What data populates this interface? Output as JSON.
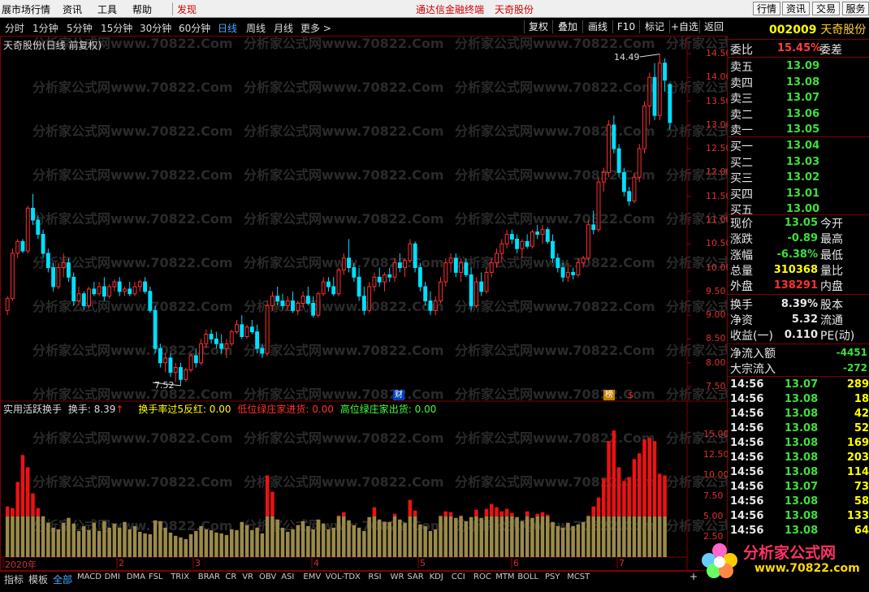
{
  "menu": {
    "items": [
      "展市场行情",
      "资讯",
      "工具",
      "帮助",
      "发现"
    ],
    "center_link": "通达信金融终端",
    "center_name": "天奇股份",
    "right_buttons": [
      "行情",
      "资讯",
      "交易",
      "服务"
    ]
  },
  "toolbar": {
    "timeframes": [
      "分时",
      "1分钟",
      "5分钟",
      "15分钟",
      "30分钟",
      "60分钟",
      "日线",
      "周线",
      "月线",
      "更多 >"
    ],
    "active": "日线",
    "actions": [
      "复权",
      "叠加",
      "画线",
      "F10",
      "标记",
      "+自选",
      "返回"
    ]
  },
  "chart_title": "天奇股份(日线 前复权)",
  "watermark": "分析家公式网www.70822.Com",
  "stock": {
    "code": "002009",
    "name": "天奇股份"
  },
  "order_book": {
    "weibi_label": "委比",
    "weibi_value": "15.45%",
    "weicha_label": "委差",
    "asks": [
      {
        "label": "卖五",
        "price": "13.09"
      },
      {
        "label": "卖四",
        "price": "13.08"
      },
      {
        "label": "卖三",
        "price": "13.07"
      },
      {
        "label": "卖二",
        "price": "13.06"
      },
      {
        "label": "卖一",
        "price": "13.05"
      }
    ],
    "bids": [
      {
        "label": "买一",
        "price": "13.04"
      },
      {
        "label": "买二",
        "price": "13.03"
      },
      {
        "label": "买三",
        "price": "13.02"
      },
      {
        "label": "买四",
        "price": "13.01"
      },
      {
        "label": "买五",
        "price": "13.00"
      }
    ]
  },
  "quote": [
    {
      "label": "现价",
      "value": "13.05",
      "color": "#3ce03c",
      "label2": "今开"
    },
    {
      "label": "涨跌",
      "value": "-0.89",
      "color": "#3ce03c",
      "label2": "最高"
    },
    {
      "label": "涨幅",
      "value": "-6.38%",
      "color": "#3ce03c",
      "label2": "最低"
    },
    {
      "label": "总量",
      "value": "310368",
      "color": "#ffff00",
      "label2": "量比"
    },
    {
      "label": "外盘",
      "value": "138291",
      "color": "#ff3030",
      "label2": "内盘"
    },
    {
      "label": "换手",
      "value": "8.39%",
      "color": "#e8e8e8",
      "label2": "股本"
    },
    {
      "label": "净资",
      "value": "5.32",
      "color": "#e8e8e8",
      "label2": "流通"
    },
    {
      "label": "收益(一)",
      "value": "0.110",
      "color": "#e8e8e8",
      "label2": "PE(动)"
    }
  ],
  "flow": [
    {
      "label": "净流入额",
      "value": "-4451"
    },
    {
      "label": "大宗流入",
      "value": "-272"
    }
  ],
  "trades": [
    {
      "time": "14:56",
      "price": "13.07",
      "vol": "289"
    },
    {
      "time": "14:56",
      "price": "13.08",
      "vol": "18"
    },
    {
      "time": "14:56",
      "price": "13.08",
      "vol": "42"
    },
    {
      "time": "14:56",
      "price": "13.08",
      "vol": "52"
    },
    {
      "time": "14:56",
      "price": "13.08",
      "vol": "169"
    },
    {
      "time": "14:56",
      "price": "13.08",
      "vol": "203"
    },
    {
      "time": "14:56",
      "price": "13.08",
      "vol": "114"
    },
    {
      "time": "14:56",
      "price": "13.07",
      "vol": "73"
    },
    {
      "time": "14:56",
      "price": "13.08",
      "vol": "58"
    },
    {
      "time": "14:56",
      "price": "13.08",
      "vol": "133"
    },
    {
      "time": "14:56",
      "price": "13.08",
      "vol": "64"
    }
  ],
  "price_axis": [
    "14.50",
    "14.00",
    "13.50",
    "13.00",
    "12.50",
    "12.00",
    "11.50",
    "11.00",
    "10.50",
    "10.00",
    "9.50",
    "9.00",
    "8.50",
    "8.00",
    "7.50"
  ],
  "annotations": {
    "high": "14.49",
    "low": "7.52",
    "cai": "财",
    "bang": "榜"
  },
  "indicator": {
    "name": "实用活跃换手",
    "huanshou": "换手: 8.39",
    "l1": "换手率过5反红: 0.00",
    "l2": "低位绿庄家进货: 0.00",
    "l3": "高位绿庄家出货: 0.00"
  },
  "ind_axis": [
    "15.00",
    "12.50",
    "10.00",
    "7.50",
    "5.00",
    "2.50"
  ],
  "date_labels": [
    "2020年",
    "2",
    "3",
    "4",
    "5",
    "6",
    "7"
  ],
  "bottom_tabs": [
    "指标",
    "模板",
    "全部",
    "MACD",
    "DMI",
    "DMA",
    "FSL",
    "TRIX",
    "BRAR",
    "CR",
    "VR",
    "OBV",
    "ASI",
    "EMV",
    "VOL-TDX",
    "RSI",
    "WR",
    "SAR",
    "KDJ",
    "CCI",
    "ROC",
    "MTM",
    "BOLL",
    "PSY",
    "MCST"
  ],
  "logo": {
    "text": "分析家公式网",
    "url": "www.70822.com"
  },
  "chart_data": {
    "type": "candlestick",
    "ylim": [
      7.3,
      14.8
    ],
    "candles": [
      [
        9.1,
        9.4,
        9.0,
        9.35
      ],
      [
        9.35,
        10.4,
        9.3,
        10.3
      ],
      [
        10.3,
        10.6,
        10.2,
        10.55
      ],
      [
        10.55,
        10.6,
        10.3,
        10.35
      ],
      [
        10.35,
        11.3,
        10.3,
        11.25
      ],
      [
        11.25,
        11.55,
        10.9,
        11.0
      ],
      [
        11.0,
        11.1,
        10.6,
        10.7
      ],
      [
        10.7,
        10.8,
        10.2,
        10.3
      ],
      [
        10.3,
        10.4,
        9.9,
        10.0
      ],
      [
        10.0,
        10.1,
        9.5,
        9.6
      ],
      [
        9.6,
        10.1,
        9.55,
        10.0
      ],
      [
        10.0,
        10.3,
        9.8,
        10.1
      ],
      [
        10.1,
        10.2,
        9.7,
        9.8
      ],
      [
        9.8,
        9.9,
        9.2,
        9.3
      ],
      [
        9.3,
        9.6,
        9.2,
        9.45
      ],
      [
        9.45,
        9.5,
        9.1,
        9.2
      ],
      [
        9.2,
        9.6,
        9.15,
        9.55
      ],
      [
        9.55,
        9.7,
        9.4,
        9.45
      ],
      [
        9.45,
        9.7,
        9.4,
        9.6
      ],
      [
        9.6,
        9.8,
        9.3,
        9.4
      ],
      [
        9.4,
        9.65,
        9.35,
        9.6
      ],
      [
        9.6,
        9.75,
        9.5,
        9.7
      ],
      [
        9.7,
        9.8,
        9.4,
        9.5
      ],
      [
        9.5,
        9.6,
        9.4,
        9.55
      ],
      [
        9.55,
        9.7,
        9.4,
        9.45
      ],
      [
        9.45,
        9.7,
        9.4,
        9.6
      ],
      [
        9.6,
        9.75,
        9.5,
        9.7
      ],
      [
        9.7,
        9.8,
        9.45,
        9.5
      ],
      [
        9.5,
        9.6,
        9.05,
        9.1
      ],
      [
        9.1,
        9.2,
        8.2,
        8.3
      ],
      [
        8.3,
        8.4,
        7.9,
        8.0
      ],
      [
        8.0,
        8.2,
        7.8,
        8.1
      ],
      [
        8.1,
        8.2,
        7.7,
        7.8
      ],
      [
        7.8,
        8.0,
        7.6,
        7.9
      ],
      [
        7.9,
        8.0,
        7.52,
        7.65
      ],
      [
        7.65,
        7.9,
        7.6,
        7.85
      ],
      [
        7.85,
        8.2,
        7.8,
        8.15
      ],
      [
        8.15,
        8.3,
        7.9,
        8.0
      ],
      [
        8.0,
        8.5,
        7.95,
        8.4
      ],
      [
        8.4,
        8.7,
        8.3,
        8.6
      ],
      [
        8.6,
        8.7,
        8.4,
        8.5
      ],
      [
        8.5,
        8.65,
        8.3,
        8.4
      ],
      [
        8.4,
        8.6,
        8.2,
        8.3
      ],
      [
        8.3,
        8.5,
        8.1,
        8.4
      ],
      [
        8.4,
        8.7,
        8.35,
        8.65
      ],
      [
        8.65,
        8.9,
        8.6,
        8.8
      ],
      [
        8.8,
        9.0,
        8.5,
        8.55
      ],
      [
        8.55,
        8.8,
        8.5,
        8.75
      ],
      [
        8.75,
        8.9,
        8.6,
        8.65
      ],
      [
        8.65,
        8.8,
        8.2,
        8.3
      ],
      [
        8.3,
        8.4,
        8.1,
        8.2
      ],
      [
        8.2,
        9.3,
        8.15,
        9.2
      ],
      [
        9.2,
        9.5,
        9.1,
        9.4
      ],
      [
        9.4,
        9.6,
        9.2,
        9.3
      ],
      [
        9.3,
        9.45,
        9.1,
        9.2
      ],
      [
        9.2,
        9.4,
        9.1,
        9.3
      ],
      [
        9.3,
        9.5,
        9.05,
        9.1
      ],
      [
        9.1,
        9.3,
        9.0,
        9.25
      ],
      [
        9.25,
        9.5,
        9.15,
        9.4
      ],
      [
        9.4,
        9.6,
        9.2,
        9.25
      ],
      [
        9.25,
        9.4,
        8.95,
        9.0
      ],
      [
        9.0,
        9.5,
        8.95,
        9.45
      ],
      [
        9.45,
        9.8,
        9.4,
        9.7
      ],
      [
        9.7,
        9.8,
        9.5,
        9.6
      ],
      [
        9.6,
        9.8,
        9.4,
        9.45
      ],
      [
        9.45,
        10.0,
        9.4,
        9.95
      ],
      [
        9.95,
        10.3,
        9.85,
        10.2
      ],
      [
        10.2,
        10.6,
        9.9,
        10.0
      ],
      [
        10.0,
        10.1,
        9.7,
        9.8
      ],
      [
        9.8,
        10.0,
        9.3,
        9.4
      ],
      [
        9.4,
        9.6,
        9.0,
        9.1
      ],
      [
        9.1,
        9.7,
        9.05,
        9.6
      ],
      [
        9.6,
        9.9,
        9.5,
        9.8
      ],
      [
        9.8,
        10.0,
        9.6,
        9.7
      ],
      [
        9.7,
        9.9,
        9.5,
        9.85
      ],
      [
        9.85,
        10.0,
        9.7,
        9.8
      ],
      [
        9.8,
        10.2,
        9.7,
        10.1
      ],
      [
        10.1,
        10.3,
        9.9,
        10.0
      ],
      [
        10.0,
        10.2,
        9.8,
        10.15
      ],
      [
        10.15,
        10.6,
        10.1,
        10.5
      ],
      [
        10.5,
        10.55,
        9.9,
        10.0
      ],
      [
        10.0,
        10.1,
        9.5,
        9.6
      ],
      [
        9.6,
        9.7,
        9.2,
        9.3
      ],
      [
        9.3,
        9.5,
        9.0,
        9.1
      ],
      [
        9.1,
        9.4,
        9.0,
        9.3
      ],
      [
        9.3,
        9.8,
        9.25,
        9.7
      ],
      [
        9.7,
        10.2,
        9.6,
        10.1
      ],
      [
        10.1,
        10.3,
        9.9,
        10.2
      ],
      [
        10.2,
        10.3,
        9.8,
        9.9
      ],
      [
        9.9,
        10.2,
        9.7,
        10.1
      ],
      [
        10.1,
        10.2,
        9.8,
        9.85
      ],
      [
        9.85,
        10.0,
        9.1,
        9.2
      ],
      [
        9.2,
        9.8,
        9.15,
        9.7
      ],
      [
        9.7,
        9.9,
        9.4,
        9.5
      ],
      [
        9.5,
        10.0,
        9.45,
        9.9
      ],
      [
        9.9,
        10.2,
        9.8,
        10.1
      ],
      [
        10.1,
        10.4,
        10.0,
        10.3
      ],
      [
        10.3,
        10.6,
        10.1,
        10.5
      ],
      [
        10.5,
        10.8,
        10.4,
        10.7
      ],
      [
        10.7,
        10.8,
        10.5,
        10.6
      ],
      [
        10.6,
        10.7,
        10.3,
        10.4
      ],
      [
        10.4,
        10.6,
        10.2,
        10.55
      ],
      [
        10.55,
        10.7,
        10.4,
        10.45
      ],
      [
        10.45,
        10.8,
        10.4,
        10.75
      ],
      [
        10.75,
        10.9,
        10.6,
        10.7
      ],
      [
        10.7,
        10.9,
        10.5,
        10.8
      ],
      [
        10.8,
        10.85,
        10.5,
        10.55
      ],
      [
        10.55,
        10.7,
        10.1,
        10.2
      ],
      [
        10.2,
        10.3,
        9.9,
        10.0
      ],
      [
        10.0,
        10.1,
        9.7,
        9.8
      ],
      [
        9.8,
        10.1,
        9.7,
        9.9
      ],
      [
        9.9,
        10.0,
        9.75,
        9.85
      ],
      [
        9.85,
        10.2,
        9.8,
        10.1
      ],
      [
        10.1,
        10.25,
        10.0,
        10.2
      ],
      [
        10.2,
        11.0,
        10.15,
        10.9
      ],
      [
        10.9,
        11.2,
        10.7,
        10.8
      ],
      [
        10.8,
        11.9,
        10.75,
        11.8
      ],
      [
        11.8,
        12.1,
        11.6,
        12.0
      ],
      [
        12.0,
        13.1,
        11.9,
        13.0
      ],
      [
        13.0,
        13.2,
        12.4,
        12.5
      ],
      [
        12.5,
        12.6,
        11.9,
        12.0
      ],
      [
        12.0,
        12.1,
        11.5,
        11.6
      ],
      [
        11.6,
        11.7,
        11.3,
        11.4
      ],
      [
        11.4,
        12.0,
        11.35,
        11.9
      ],
      [
        11.9,
        12.6,
        11.8,
        12.5
      ],
      [
        12.5,
        13.5,
        12.4,
        13.4
      ],
      [
        13.4,
        14.1,
        13.0,
        14.0
      ],
      [
        14.0,
        14.3,
        13.1,
        13.2
      ],
      [
        13.2,
        14.49,
        13.1,
        14.3
      ],
      [
        14.3,
        14.4,
        13.7,
        13.94
      ],
      [
        13.85,
        13.88,
        12.9,
        13.05
      ]
    ],
    "volume": [
      6.2,
      6.0,
      9.2,
      12.5,
      11.0,
      7.8,
      6.0,
      5.0,
      4.2,
      3.6,
      3.4,
      4.2,
      4.8,
      4.1,
      3.2,
      3.8,
      3.3,
      4.2,
      3.2,
      4.4,
      3.6,
      4.1,
      3.6,
      4.3,
      3.4,
      3.8,
      3.1,
      2.9,
      2.8,
      4.5,
      4.4,
      3.6,
      3.0,
      2.6,
      2.4,
      2.2,
      2.8,
      3.2,
      3.8,
      3.4,
      3.3,
      3.0,
      2.9,
      2.7,
      3.4,
      3.3,
      4.3,
      3.9,
      3.3,
      3.6,
      2.9,
      10.0,
      8.0,
      4.6,
      3.6,
      3.1,
      3.4,
      3.9,
      4.4,
      3.8,
      3.4,
      4.6,
      4.1,
      3.4,
      3.6,
      5.1,
      5.5,
      4.5,
      3.9,
      3.6,
      3.2,
      4.9,
      6.1,
      4.6,
      4.3,
      4.3,
      5.3,
      4.6,
      4.2,
      7.0,
      5.7,
      4.0,
      3.8,
      3.2,
      3.4,
      5.1,
      5.6,
      5.5,
      4.8,
      5.1,
      4.4,
      4.9,
      5.8,
      4.8,
      5.9,
      6.5,
      6.1,
      5.6,
      5.9,
      5.4,
      4.9,
      4.4,
      5.6,
      4.8,
      5.3,
      5.5,
      5.2,
      4.3,
      3.8,
      3.6,
      4.2,
      3.8,
      4.0,
      4.3,
      5.1,
      6.2,
      7.3,
      9.6,
      14.2,
      15.5,
      11.0,
      9.3,
      9.8,
      12.0,
      12.7,
      14.4,
      14.6,
      14.2,
      10.2,
      10.0
    ]
  }
}
